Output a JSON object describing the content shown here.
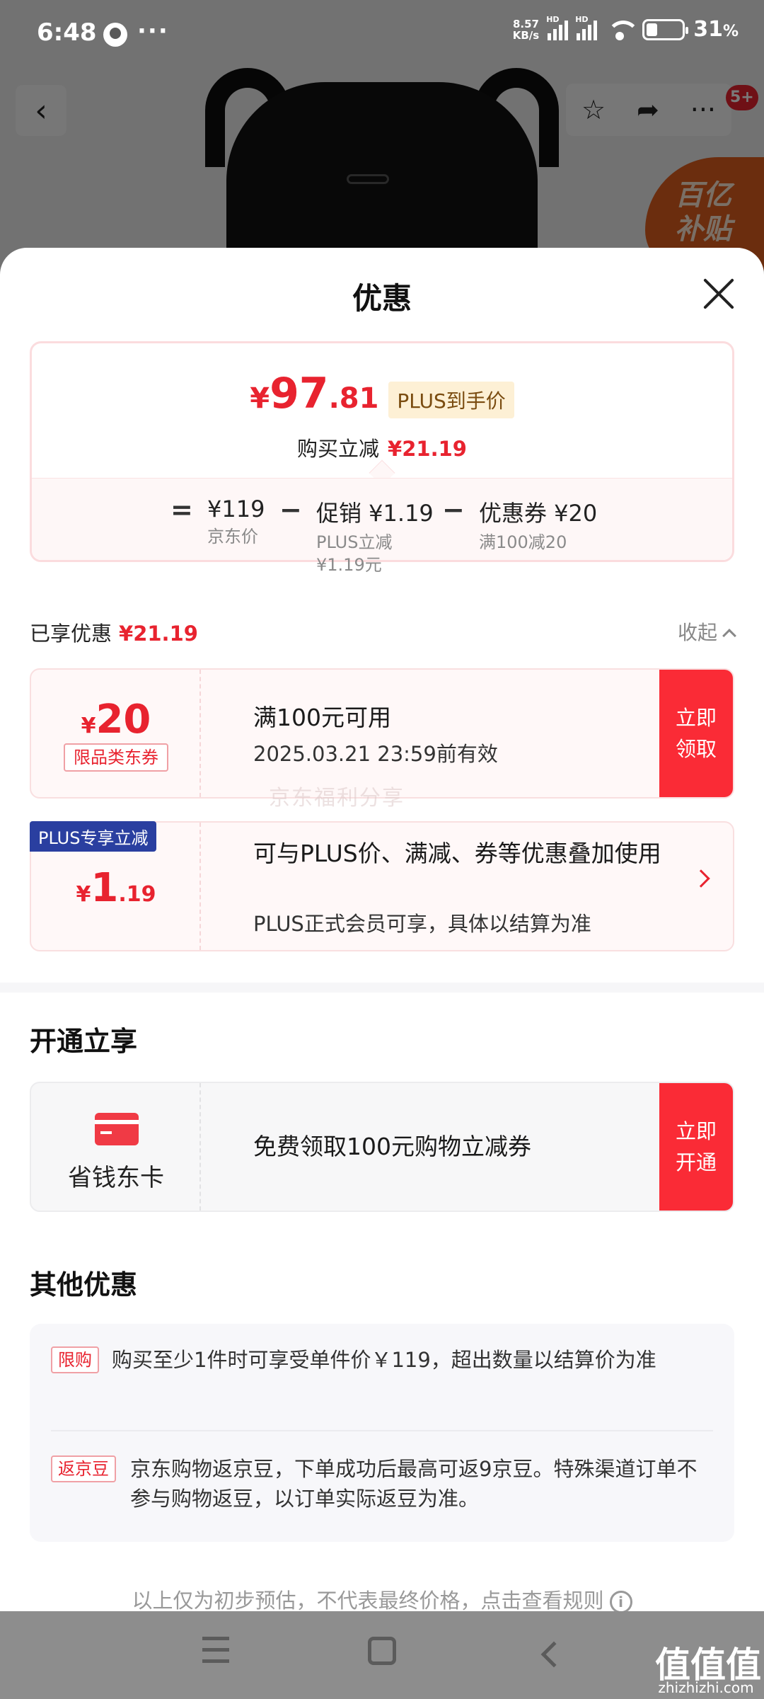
{
  "status_bar": {
    "time": "6:48",
    "more": "···",
    "net_speed_value": "8.57",
    "net_speed_unit": "KB/s",
    "sim1": "HD",
    "sim2": "HD",
    "battery_percent": "31",
    "battery_unit": "%",
    "battery_level": 0.31
  },
  "background_page": {
    "back_icon": "chevron-left-icon",
    "more_dots": "···",
    "badge": "5+",
    "subsidy_line1": "百亿",
    "subsidy_line2": "补贴"
  },
  "sheet": {
    "title": "优惠",
    "price": {
      "currency": "¥",
      "integer": "97",
      "decimal": ".81",
      "plus_tag": "PLUS到手价",
      "reduce_label": "购买立减",
      "reduce_amount": "¥21.19"
    },
    "calc": {
      "eq": "=",
      "minus": "−",
      "items": [
        {
          "main": "¥119",
          "sub": "京东价"
        },
        {
          "main": "促销 ¥1.19",
          "sub": "PLUS立减",
          "sub2": "¥1.19元"
        },
        {
          "main": "优惠券 ¥20",
          "sub": "满100减20"
        }
      ]
    },
    "enjoyed": {
      "label": "已享优惠",
      "amount": "¥21.19",
      "collapse": "收起"
    },
    "coupon1": {
      "currency": "¥",
      "amount": "20",
      "tag": "限品类东券",
      "title": "满100元可用",
      "validity": "2025.03.21 23:59前有效",
      "action_line1": "立即",
      "action_line2": "领取"
    },
    "watermark": "京东福利分享",
    "coupon2": {
      "ribbon": "PLUS专享立减",
      "currency": "¥",
      "amount_int": "1",
      "amount_dec": ".19",
      "title": "可与PLUS价、满减、券等优惠叠加使用",
      "desc": "PLUS正式会员可享，具体以结算为准"
    },
    "open_section": {
      "title": "开通立享",
      "card_name": "省钱东卡",
      "card_desc": "免费领取100元购物立减券",
      "action_line1": "立即",
      "action_line2": "开通"
    },
    "other_section": {
      "title": "其他优惠",
      "items": [
        {
          "tag": "限购",
          "text": "购买至少1件时可享受单件价￥119，超出数量以结算价为准"
        },
        {
          "tag": "返京豆",
          "text": "京东购物返京豆，下单成功后最高可返9京豆。特殊渠道订单不参与购物返豆，以订单实际返豆为准。"
        }
      ]
    },
    "footnote": "以上仅为初步预估，不代表最终价格，点击查看规则",
    "info_icon": "i"
  },
  "watermark_site": {
    "mark": "值值值",
    "url": "zhizhizhi.com"
  },
  "colors": {
    "accent_red": "#e8232f",
    "action_red": "#fa2b36",
    "plus_blue": "#2a3fa0",
    "plus_tag_bg": "#fdf0d5"
  }
}
